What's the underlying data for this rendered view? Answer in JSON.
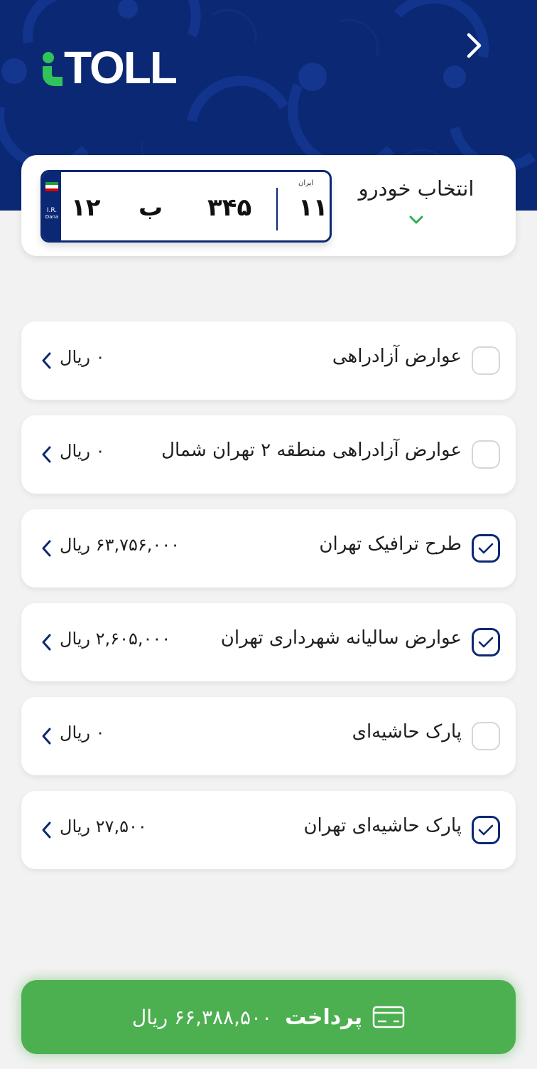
{
  "app": {
    "logo_text": "TOLL",
    "brand_colors": {
      "primary": "#0b2874",
      "accent": "#2fc35a",
      "pay": "#4caf50"
    }
  },
  "header": {
    "back_icon": "chevron-right-icon"
  },
  "vehicle": {
    "select_label": "انتخاب خودرو",
    "plate": {
      "part1": "۱۲",
      "letter": "ب",
      "part2": "۳۴۵",
      "region": "۱۱",
      "region_caption": "ایران",
      "country_code": "I.R.",
      "country_sub": "Dana"
    }
  },
  "items": [
    {
      "title": "عوارض آزادراهی",
      "amount": "۰ ریال",
      "checked": false
    },
    {
      "title": "عوارض آزادراهی منطقه ۲ تهران شمال",
      "amount": "۰ ریال",
      "checked": false
    },
    {
      "title": "طرح ترافیک تهران",
      "amount": "۶۳,۷۵۶,۰۰۰ ریال",
      "checked": true
    },
    {
      "title": "عوارض سالیانه شهرداری تهران",
      "amount": "۲,۶۰۵,۰۰۰ ریال",
      "checked": true
    },
    {
      "title": "پارک حاشیه‌ای",
      "amount": "۰ ریال",
      "checked": false
    },
    {
      "title": "پارک حاشیه‌ای تهران",
      "amount": "۲۷,۵۰۰ ریال",
      "checked": true
    }
  ],
  "pay": {
    "label": "پرداخت",
    "amount": "۶۶,۳۸۸,۵۰۰ ریال",
    "icon": "credit-card-icon"
  }
}
